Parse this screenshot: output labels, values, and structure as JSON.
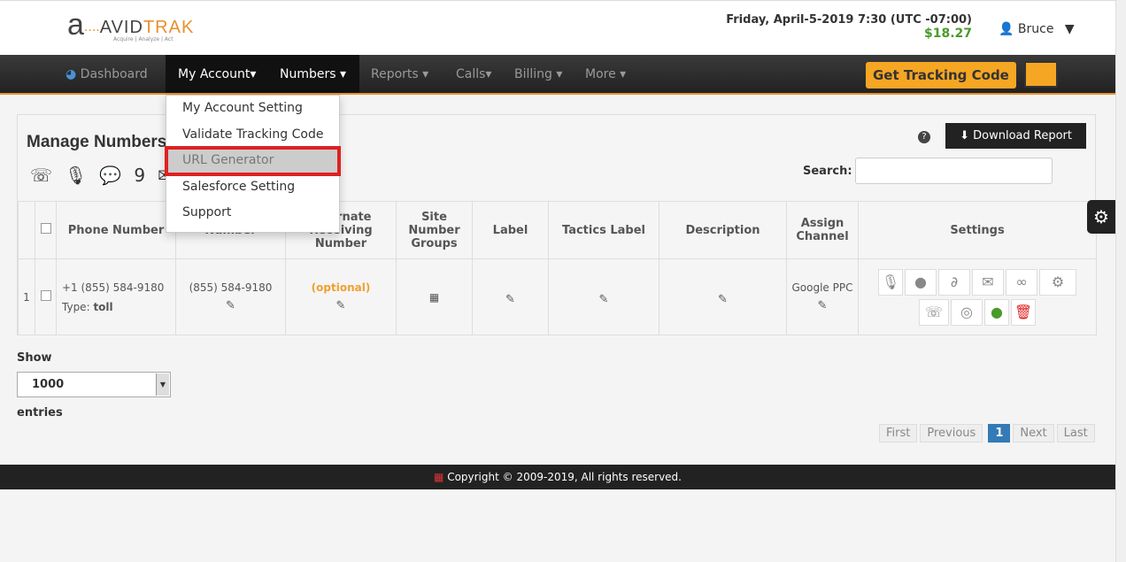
{
  "brand": {
    "logo_text_1": "AVID",
    "logo_text_2": "TRAK",
    "tagline": "Acquire | Analyze | Act"
  },
  "header": {
    "datetime": "Friday, April-5-2019 7:30 (UTC -07:00)",
    "balance": "$18.27",
    "user": "Bruce"
  },
  "nav": {
    "items": [
      {
        "label": "Dashboard"
      },
      {
        "label": "My Account▾"
      },
      {
        "label": "Numbers ▾"
      },
      {
        "label": "Reports ▾"
      },
      {
        "label": "Calls▾"
      },
      {
        "label": "Billing ▾"
      },
      {
        "label": "More ▾"
      }
    ],
    "get_tracking_code": "Get Tracking Code"
  },
  "dropdown": {
    "items": [
      "My Account Setting",
      "Validate Tracking Code",
      "URL Generator",
      "Salesforce Setting",
      "Support"
    ],
    "highlighted": "URL Generator"
  },
  "panel": {
    "title": "Manage Numbers",
    "download": "Download Report",
    "search_label": "Search:",
    "search_value": ""
  },
  "table": {
    "headers": [
      "",
      "",
      "Phone Number",
      "Number",
      "Alternate Receiving Number",
      "Site Number Groups",
      "Label",
      "Tactics Label",
      "Description",
      "Assign Channel",
      "Settings"
    ],
    "rows": [
      {
        "index": "1",
        "phone": "+1 (855) 584-9180",
        "type_label": "Type:",
        "type": "toll",
        "number": "(855) 584-9180",
        "alternate": "(optional)",
        "channel": "Google PPC"
      }
    ]
  },
  "show": {
    "label": "Show",
    "value": "1000",
    "suffix": "entries"
  },
  "pager": {
    "first": "First",
    "previous": "Previous",
    "current": "1",
    "next": "Next",
    "last": "Last"
  },
  "footer": {
    "copyright": "Copyright © 2009-2019, All rights reserved."
  },
  "colors": {
    "accent": "#e8902c",
    "balance": "#4a9a2c",
    "highlight_box": "#e02020",
    "pager_active": "#337ab7"
  }
}
